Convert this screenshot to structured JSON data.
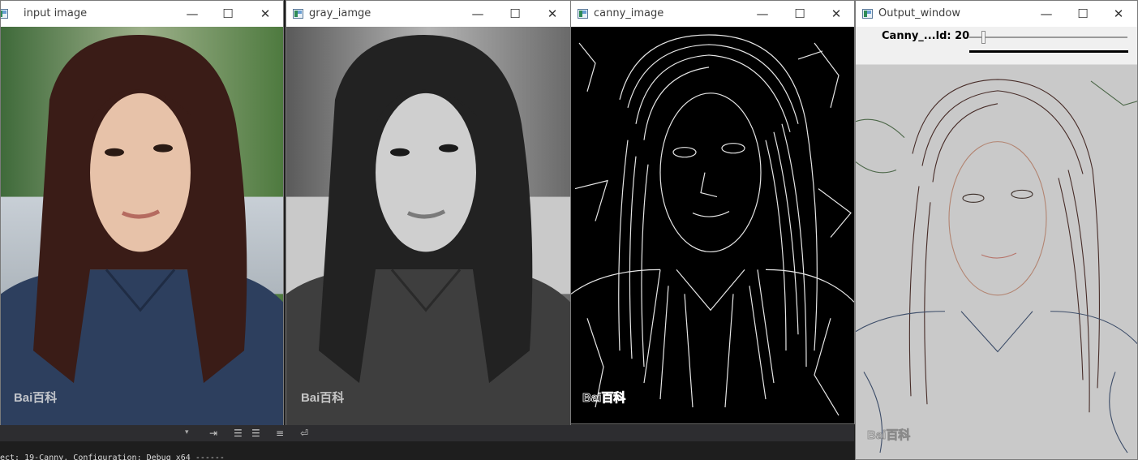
{
  "windows": {
    "input": {
      "title": "input image",
      "watermark": "Bai百科"
    },
    "gray": {
      "title": "gray_iamge",
      "watermark": "Bai百科"
    },
    "canny": {
      "title": "canny_image",
      "watermark": "Bai百科"
    },
    "output": {
      "title": "Output_window",
      "watermark": "Bai百科"
    }
  },
  "controls": {
    "minimize": "—",
    "maximize": "☐",
    "close": "✕"
  },
  "trackbar": {
    "label": "Canny_...ld: 20",
    "value": 20,
    "max": 255
  },
  "ide": {
    "toolbar_dropdown": "▾",
    "output_text": "ect: 19-Canny, Configuration: Debug x64 ------"
  },
  "colors": {
    "window_bg": "#ffffff",
    "ide_bg": "#1e1e1e",
    "canny_bg": "#000000",
    "output_bg": "#c9c9c9"
  },
  "icons": [
    "app-icon",
    "minimize-icon",
    "maximize-icon",
    "close-icon",
    "indent-icon",
    "list-icon",
    "wrap-icon"
  ]
}
